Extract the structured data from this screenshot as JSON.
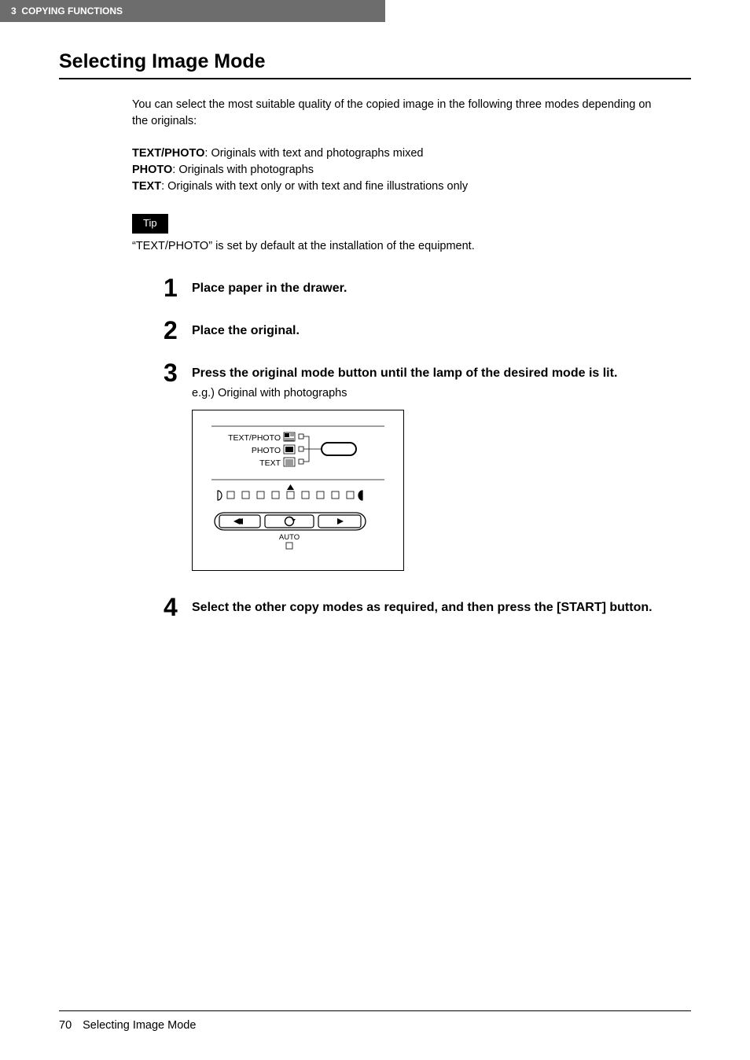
{
  "header": {
    "chapter_num": "3",
    "chapter_title": "COPYING FUNCTIONS"
  },
  "section_title": "Selecting Image Mode",
  "intro": "You can select the most suitable quality of the copied image in the following three modes depending on the originals:",
  "definitions": [
    {
      "label": "TEXT/PHOTO",
      "desc": ": Originals with text and photographs mixed"
    },
    {
      "label": "PHOTO",
      "desc": ": Originals with photographs"
    },
    {
      "label": "TEXT",
      "desc": ": Originals with text only or with text and fine illustrations only"
    }
  ],
  "tip": {
    "label": "Tip",
    "text": "“TEXT/PHOTO” is set by default at the installation of the equipment."
  },
  "steps": [
    {
      "num": "1",
      "title": "Place paper in the drawer."
    },
    {
      "num": "2",
      "title": "Place the original."
    },
    {
      "num": "3",
      "title": "Press the original mode button until the lamp of the desired mode is lit.",
      "subtext": "e.g.) Original with photographs"
    },
    {
      "num": "4",
      "title": "Select the other copy modes as required, and then press the [START] button."
    }
  ],
  "panel": {
    "mode1": "TEXT/PHOTO",
    "mode2": "PHOTO",
    "mode3": "TEXT",
    "auto": "AUTO"
  },
  "footer": {
    "page": "70",
    "title": "Selecting Image Mode"
  }
}
